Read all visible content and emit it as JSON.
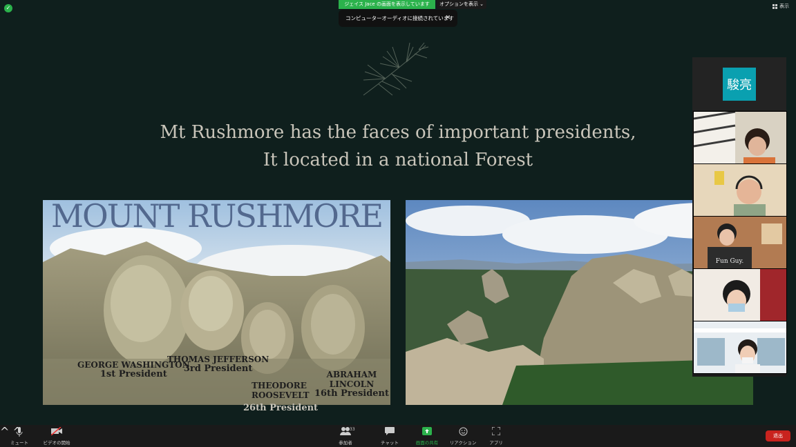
{
  "meeting": {
    "sharing_banner": "ジェイス Jace の画面を表示しています",
    "options_label": "オプションを表示",
    "audio_notice": "コンピューターオーディオに接続されています",
    "notice_close_icon": "close-icon",
    "view_label": "表示"
  },
  "slide": {
    "headline_line1": "Mt Rushmore has the faces of important presidents,",
    "headline_line2": "It located in a national Forest",
    "photo1": {
      "title": "MOUNT RUSHMORE",
      "labels": [
        {
          "name": "GEORGE WASHINGTON",
          "role": "1st President"
        },
        {
          "name": "THOMAS JEFFERSON",
          "role": "3rd President"
        },
        {
          "name": "THEODORE ROOSEVELT",
          "role": "26th President"
        },
        {
          "name": "ABRAHAM LINCOLN",
          "role": "16th President"
        }
      ]
    }
  },
  "participants": {
    "avatar_text": "駿亮",
    "video_tiles": [
      "participant-1",
      "participant-2",
      "participant-3",
      "participant-4",
      "participant-5"
    ],
    "shirt_text": "Fun Guy."
  },
  "toolbar": {
    "mute": "ミュート",
    "video": "ビデオの開始",
    "participants": "参加者",
    "participants_count": "33",
    "chat": "チャット",
    "share": "画面の共有",
    "reactions": "リアクション",
    "apps": "アプリ",
    "leave": "退出"
  },
  "colors": {
    "share_green": "#2bb24c",
    "leave_red": "#c9231e",
    "avatar_teal": "#0aa0b0",
    "slide_bg": "#0f1f1d"
  }
}
